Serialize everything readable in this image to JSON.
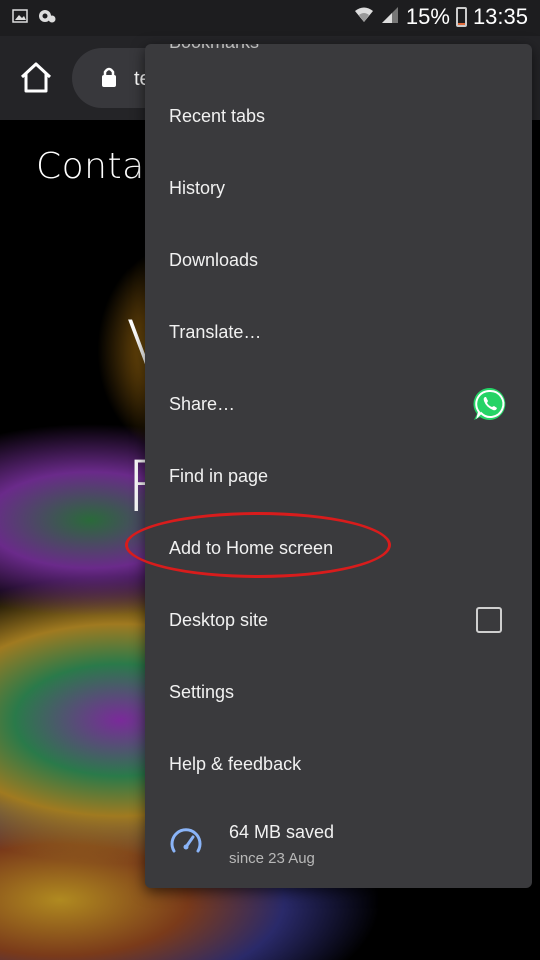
{
  "status_bar": {
    "battery_percent": "15%",
    "battery_level": 0.15,
    "time": "13:35",
    "left_icons": [
      "image-icon",
      "chrome-savings-icon"
    ],
    "right_icons": [
      "wifi-icon",
      "signal-icon",
      "battery-icon"
    ],
    "colors": {
      "battery_low": "#e06a3a"
    }
  },
  "toolbar": {
    "url_partial": "te",
    "icons": [
      "home-icon",
      "lock-icon"
    ]
  },
  "page": {
    "heading_partial": "Contac",
    "large_glyph_1": "V",
    "large_glyph_2": "F"
  },
  "menu": {
    "cut_off_item": "Bookmarks",
    "items": [
      {
        "label": "Recent tabs"
      },
      {
        "label": "History"
      },
      {
        "label": "Downloads"
      },
      {
        "label": "Translate…"
      },
      {
        "label": "Share…",
        "icon": "whatsapp-icon"
      },
      {
        "label": "Find in page"
      },
      {
        "label": "Add to Home screen",
        "highlighted": true
      },
      {
        "label": "Desktop site",
        "checked": false
      },
      {
        "label": "Settings"
      },
      {
        "label": "Help & feedback"
      }
    ],
    "data_saver": {
      "amount": "64 MB saved",
      "since": "since 23 Aug",
      "icon": "speedometer-icon"
    }
  },
  "colors": {
    "menu_bg": "#3a3a3d",
    "highlight_ring": "#d81c1c",
    "accent_blue": "#8ab4f8",
    "whatsapp_green": "#25d366"
  }
}
